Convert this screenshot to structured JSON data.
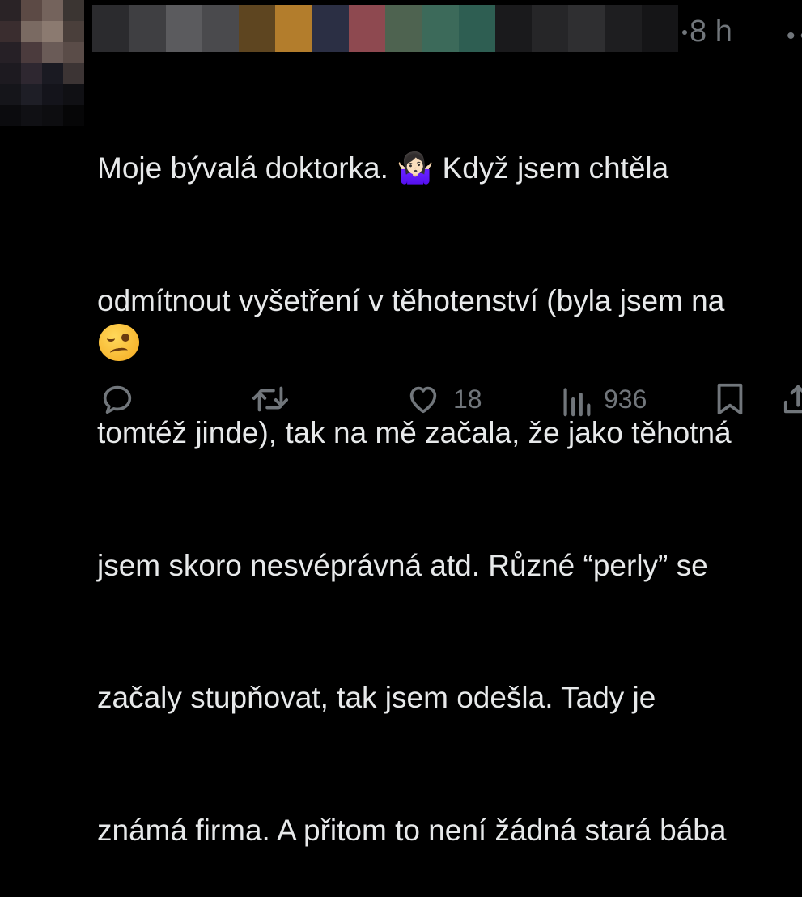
{
  "post": {
    "time": "8 h",
    "more_glyph": "••",
    "lines": [
      "Moje bývalá doktorka. 🤷🏻‍♀️ Když jsem chtěla",
      "odmítnout vyšetření v těhotenství (byla jsem na",
      "tomtéž jinde), tak na mě začala, že jako těhotná",
      "jsem skoro nesvéprávná atd. Různé “perly” se",
      "začaly stupňovat, tak jsem odešla. Tady je",
      "známá firma. A přitom to není žádná stará bába"
    ],
    "trailing_emoji": "woozy-face"
  },
  "actions": {
    "reply": {
      "icon": "reply-icon",
      "count": ""
    },
    "repost": {
      "icon": "repost-icon",
      "count": ""
    },
    "like": {
      "icon": "heart-icon",
      "count": "18"
    },
    "views": {
      "icon": "views-icon",
      "count": "936"
    },
    "bookmark": {
      "icon": "bookmark-icon"
    },
    "share": {
      "icon": "share-icon"
    }
  },
  "colors": {
    "background": "#000000",
    "text": "#e7e9ea",
    "muted": "#71767b"
  }
}
